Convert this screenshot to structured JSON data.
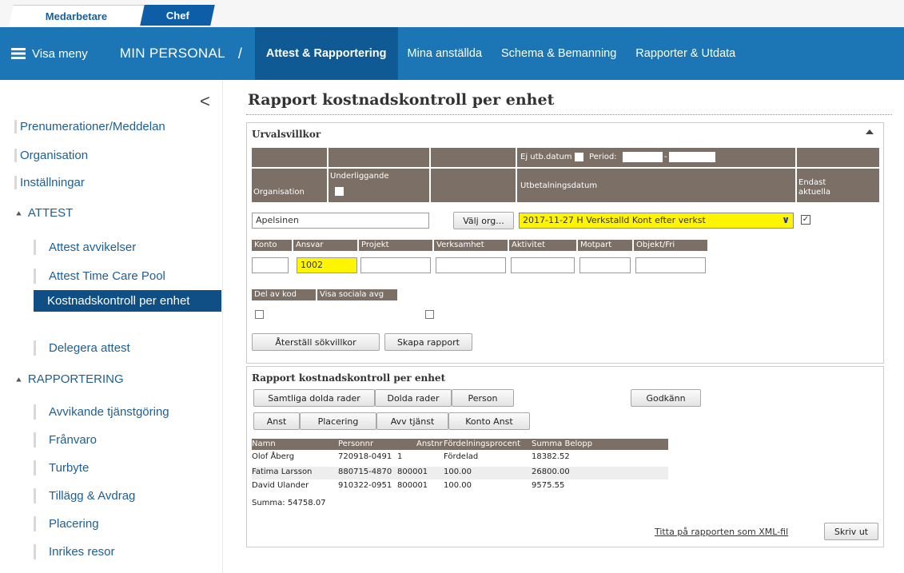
{
  "tabs": {
    "medarbetare": "Medarbetare",
    "chef": "Chef"
  },
  "nav": {
    "menu_label": "Visa meny",
    "section_title": "MIN PERSONAL",
    "separator": "/",
    "items": [
      {
        "label": "Attest & Rapportering",
        "active": true
      },
      {
        "label": "Mina anställda",
        "active": false
      },
      {
        "label": "Schema & Bemanning",
        "active": false
      },
      {
        "label": "Rapporter & Utdata",
        "active": false
      }
    ]
  },
  "sidebar": {
    "collapse_glyph": "<",
    "top_items": [
      "Prenumerationer/Meddelan⁠",
      "Organisation",
      "Inställningar"
    ],
    "sections": [
      {
        "label": "ATTEST",
        "items": [
          "Attest avvikelser",
          "Attest Time Care Pool",
          "Kostnadskontroll per enhet",
          "Delegera attest"
        ],
        "active_item": "Kostnadskontroll per enhet"
      },
      {
        "label": "RAPPORTERING",
        "items": [
          "Avvikande tjänstgöring",
          "Frånvaro",
          "Turbyte",
          "Tillägg & Avdrag",
          "Placering",
          "Inrikes resor"
        ]
      }
    ]
  },
  "page": {
    "title": "Rapport kostnadskontroll per enhet"
  },
  "criteria": {
    "panel_title": "Urvalsvillkor",
    "ej_utb_label": "Ej utb.datum",
    "period_label": "Period:",
    "period_dash": "-",
    "headers": {
      "organisation": "Organisation",
      "underliggande": "Underliggande",
      "utbetalningsdatum": "Utbetalningsdatum",
      "endast_line1": "Endast",
      "endast_line2": "aktuella"
    },
    "organisation_value": "Apelsinen",
    "valj_org_button": "Välj org...",
    "utbetalning_selected": "2017-11-27 H Verkstalld Kont efter verkst",
    "endast_aktuella_checked": true,
    "code_labels": [
      "Konto",
      "Ansvar",
      "Projekt",
      "Verksamhet",
      "Aktivitet",
      "Motpart",
      "Objekt/Fri"
    ],
    "code_values": [
      "",
      "1002",
      "",
      "",
      "",
      "",
      ""
    ],
    "del_av_kod_label": "Del av kod",
    "visa_sociala_label": "Visa sociala avg",
    "reset_button": "Återställ sökvillkor",
    "create_button": "Skapa rapport"
  },
  "report": {
    "panel_title": "Rapport kostnadskontroll per enhet",
    "buttons_row1": [
      "Samtliga dolda rader",
      "Dolda rader",
      "Person"
    ],
    "approve_button": "Godkänn",
    "buttons_row2": [
      "Anst",
      "Placering",
      "Avv tjänst",
      "Konto Anst"
    ],
    "columns": [
      "Namn",
      "Personnr",
      "Anstnr",
      "Fördelningsprocent",
      "Summa Belopp"
    ],
    "rows": [
      [
        "Olof Åberg",
        "720918-0491",
        "1",
        "Fördelad",
        "18382.52"
      ],
      [
        "Fatima Larsson",
        "880715-4870",
        "800001",
        "100.00",
        "26800.00"
      ],
      [
        "David Ulander",
        "910322-0951",
        "800001",
        "100.00",
        "9575.55"
      ]
    ],
    "summa": "Summa: 54758.07",
    "xml_link": "Titta på rapporten som XML-fil",
    "print_button": "Skriv ut"
  },
  "colors": {
    "nav_blue": "#1c76b5",
    "nav_active": "#0f5a94",
    "header_brown": "#7b6f66",
    "highlight_yellow": "#fff500",
    "link_blue": "#1d5f95"
  }
}
